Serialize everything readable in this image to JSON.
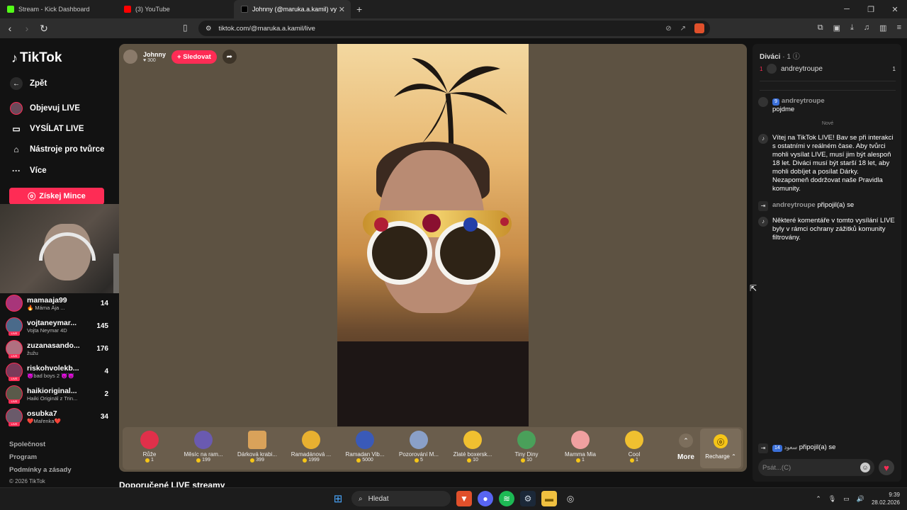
{
  "browser": {
    "tabs": [
      {
        "title": "Stream - Kick Dashboard",
        "favicon_color": "#53fc18"
      },
      {
        "title": "(3) YouTube",
        "favicon_color": "#ff0000"
      },
      {
        "title": "Johnny (@maruka.a.kamil) vy",
        "favicon_color": "#000000"
      }
    ],
    "url": "tiktok.com/@maruka.a.kamil/live"
  },
  "sidebar": {
    "brand": "TikTok",
    "back": "Zpět",
    "nav": [
      {
        "label": "Objevuj LIVE",
        "icon": "live-avatar-icon"
      },
      {
        "label": "VYSÍLAT LIVE",
        "icon": "camera-icon"
      },
      {
        "label": "Nástroje pro tvůrce",
        "icon": "home-icon"
      },
      {
        "label": "Více",
        "icon": "more-icon"
      }
    ],
    "coins_button": "Získej Mince",
    "following": [
      {
        "name": "mamaaja99",
        "sub": "🔥 Máma Ája ...",
        "count": "14"
      },
      {
        "name": "vojtaneymar...",
        "sub": "Vojta Neymar 4D",
        "count": "145"
      },
      {
        "name": "zuzanasando...",
        "sub": "žužu",
        "count": "176"
      },
      {
        "name": "riskohvolekb...",
        "sub": "😈bad boys 2 😈😈",
        "count": "4"
      },
      {
        "name": "haikioriginal...",
        "sub": "Haiki Originál z Trin...",
        "count": "2"
      },
      {
        "name": "osubka7",
        "sub": "❤️Mařenka❤️",
        "count": "34"
      }
    ],
    "footer": [
      "Společnost",
      "Program",
      "Podmínky a zásady",
      "© 2026 TikTok"
    ]
  },
  "stream": {
    "streamer_name": "Johnny",
    "likes": "300",
    "follow_button": "+ Sledovat",
    "gifts": [
      {
        "name": "Růže",
        "price": "1",
        "color": "#e0304a"
      },
      {
        "name": "Měsíc na ram...",
        "price": "199",
        "color": "#6a5ab0"
      },
      {
        "name": "Dárková krabi...",
        "price": "399",
        "color": "#d9a25a"
      },
      {
        "name": "Ramadánová ...",
        "price": "1999",
        "color": "#e8b030"
      },
      {
        "name": "Ramadan Vib...",
        "price": "5000",
        "color": "#3a5ab8"
      },
      {
        "name": "Pozorování M...",
        "price": "5",
        "color": "#8aa0c8"
      },
      {
        "name": "Zlaté boxersk...",
        "price": "10",
        "color": "#f0c030"
      },
      {
        "name": "Tiny Diny",
        "price": "10",
        "color": "#4aa05a"
      },
      {
        "name": "Mamma Mia",
        "price": "1",
        "color": "#f0a0a0"
      },
      {
        "name": "Cool",
        "price": "1",
        "color": "#f0c030"
      }
    ],
    "more": "More",
    "recharge": "Recharge ⌃"
  },
  "recommended": "Doporučené LIVE streamy",
  "chat": {
    "viewers_label": "Diváci",
    "viewers_count": "· 1",
    "top_viewer": {
      "rank": "1",
      "name": "andreytroupe",
      "score": "1"
    },
    "messages": [
      {
        "level": "9",
        "user": "andreytroupe",
        "text": "pojdme"
      }
    ],
    "new_label": "Nové",
    "system_welcome": "Vítej na TikTok LIVE! Bav se při interakci s ostatními v reálném čase. Aby tvůrci mohli vysílat LIVE, musí jim být alespoň 18 let. Diváci musí být starší 18 let, aby mohli dobíjet a posílat Dárky. Nezapomeň dodržovat naše Pravidla komunity.",
    "join_user": "andreytroupe",
    "join_text": "připojil(a) se",
    "filter_notice": "Některé komentáře v tomto vysílání LIVE byly v rámci ochrany zážitků komunity filtrovány.",
    "bottom_join_level": "14",
    "bottom_join_user": "سعود",
    "bottom_join_text": "připojil(a) se",
    "input_placeholder": "Psát...(C)"
  },
  "taskbar": {
    "search": "Hledat",
    "time": "9:39",
    "date": "28.02.2026"
  }
}
